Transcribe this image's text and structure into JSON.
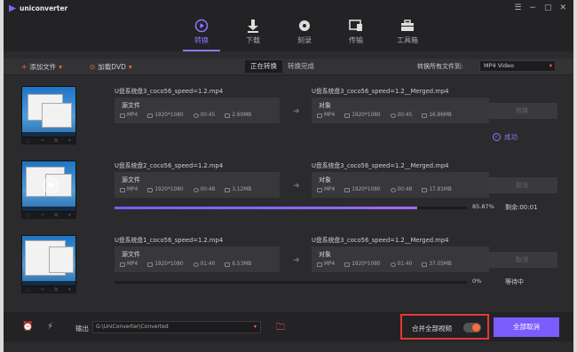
{
  "app": {
    "name": "uniconverter"
  },
  "nav": [
    {
      "label": "转换",
      "active": true
    },
    {
      "label": "下载",
      "active": false
    },
    {
      "label": "刻录",
      "active": false
    },
    {
      "label": "传输",
      "active": false
    },
    {
      "label": "工具箱",
      "active": false
    }
  ],
  "toolbar": {
    "add_files": "添加文件",
    "load_dvd": "加载DVD",
    "tab_converting": "正在转换",
    "tab_converted": "转换完成",
    "convert_all_to": "转换所有文件到:",
    "format": "MP4 Video"
  },
  "items": [
    {
      "src_name": "U盘系统盘3_coco56_speed=1.2.mp4",
      "src_label": "源文件",
      "src_format": "MP4",
      "src_res": "1920*1080",
      "src_dur": "00:45",
      "src_size": "2.60MB",
      "dst_name": "U盘系统盘3_coco56_speed=1.2__Merged.mp4",
      "dst_label": "对象",
      "dst_format": "MP4",
      "dst_res": "1920*1080",
      "dst_dur": "00:45",
      "dst_size": "16.86MB",
      "action": "转换",
      "status": "成功",
      "progress": null
    },
    {
      "src_name": "U盘系统盘2_coco56_speed=1.2.mp4",
      "src_label": "源文件",
      "src_format": "MP4",
      "src_res": "1920*1080",
      "src_dur": "00:48",
      "src_size": "3.12MB",
      "dst_name": "U盘系统盘3_coco56_speed=1.2__Merged.mp4",
      "dst_label": "对象",
      "dst_format": "MP4",
      "dst_res": "1920*1080",
      "dst_dur": "00:48",
      "dst_size": "17.81MB",
      "action": "取消",
      "percent": "85.87%",
      "status": "剩余:00:01",
      "progress": 0.8587
    },
    {
      "src_name": "U盘系统盘1_coco56_speed=1.2.mp4",
      "src_label": "源文件",
      "src_format": "MP4",
      "src_res": "1920*1080",
      "src_dur": "01:40",
      "src_size": "6.53MB",
      "dst_name": "U盘系统盘3_coco56_speed=1.2__Merged.mp4",
      "dst_label": "对象",
      "dst_format": "MP4",
      "dst_res": "1920*1080",
      "dst_dur": "01:40",
      "dst_size": "37.05MB",
      "action": "取消",
      "percent": "0%",
      "status": "等待中",
      "progress": 0
    }
  ],
  "footer": {
    "output_label": "输出",
    "output_path": "G:\\UniConverter\\Converted",
    "merge_label": "合并全部视频",
    "merge_on": true,
    "cancel_all": "全部取消"
  },
  "colors": {
    "accent": "#7a5cff",
    "orange": "#ff6a3d",
    "highlight": "#e53935"
  }
}
